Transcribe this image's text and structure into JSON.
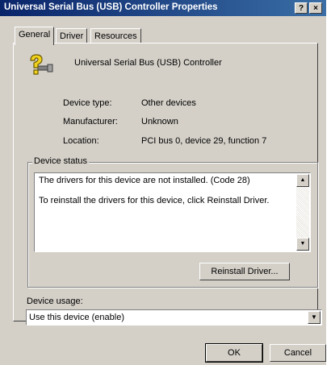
{
  "window": {
    "title": "Universal Serial Bus (USB) Controller Properties",
    "help_label": "?",
    "close_label": "×"
  },
  "tabs": [
    "General",
    "Driver",
    "Resources"
  ],
  "device": {
    "name": "Universal Serial Bus (USB) Controller",
    "icon": "unknown-device-question-icon",
    "type_label": "Device type:",
    "type_value": "Other devices",
    "manufacturer_label": "Manufacturer:",
    "manufacturer_value": "Unknown",
    "location_label": "Location:",
    "location_value": "PCI bus 0, device 29, function 7"
  },
  "status": {
    "group_label": "Device status",
    "line1": "The drivers for this device are not installed. (Code 28)",
    "line2": "To reinstall the drivers for this device, click Reinstall Driver.",
    "reinstall_button": "Reinstall Driver..."
  },
  "usage": {
    "label": "Device usage:",
    "value": "Use this device (enable)"
  },
  "buttons": {
    "ok": "OK",
    "cancel": "Cancel"
  },
  "colors": {
    "titlebar_start": "#0a246a",
    "titlebar_end": "#3a6ea5",
    "face": "#d4d0c8",
    "icon_yellow": "#f2d21b"
  }
}
